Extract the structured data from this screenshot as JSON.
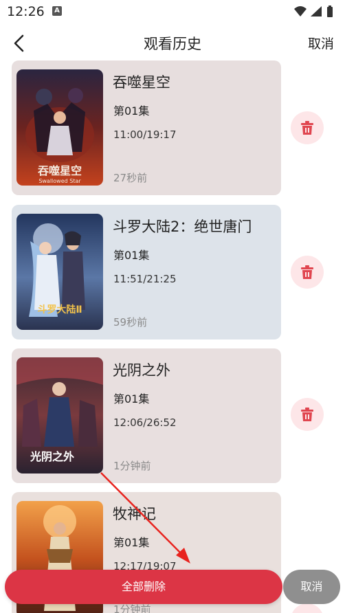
{
  "status": {
    "time": "12:26",
    "notif_letter": "A"
  },
  "nav": {
    "title": "观看历史",
    "cancel": "取消"
  },
  "history": [
    {
      "title": "吞噬星空",
      "episode": "第01集",
      "progress": "11:00/19:17",
      "ago": "27秒前",
      "poster_text": "吞噬星空",
      "poster_sub": "Swallowed Star",
      "card_color": "#e7dede"
    },
    {
      "title": "斗罗大陆2：绝世唐门",
      "episode": "第01集",
      "progress": "11:51/21:25",
      "ago": "59秒前",
      "poster_text": "斗罗大陆Ⅱ",
      "card_color": "#dde3ea"
    },
    {
      "title": "光阴之外",
      "episode": "第01集",
      "progress": "12:06/26:52",
      "ago": "1分钟前",
      "poster_text": "光阴之外",
      "card_color": "#e8dfdf"
    },
    {
      "title": "牧神记",
      "episode": "第01集",
      "progress": "12:17/19:07",
      "ago": "1分钟前",
      "card_color": "#e9e0dd"
    }
  ],
  "actions": {
    "delete_all": "全部删除",
    "cancel": "取消"
  },
  "colors": {
    "delete_red": "#dc3545",
    "delete_icon_bg": "#fde6e8",
    "cancel_gray": "#8f8f8f",
    "annotation_arrow": "#e8231e"
  }
}
